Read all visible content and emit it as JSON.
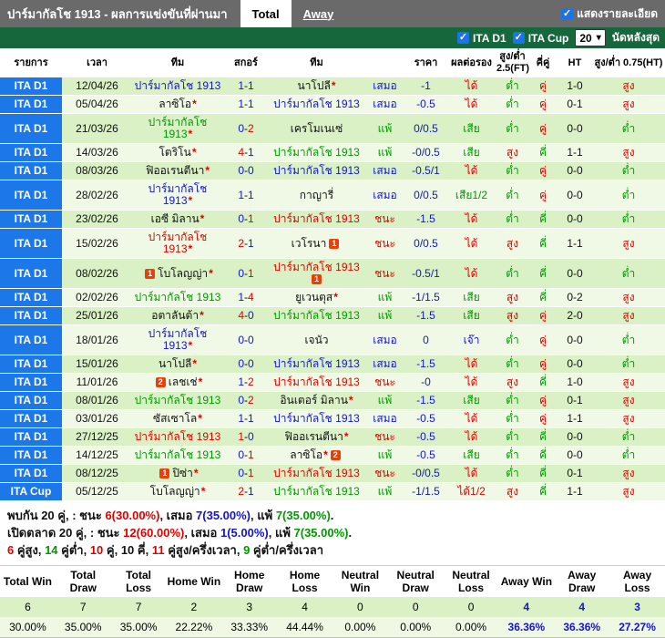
{
  "colors": {
    "win_red": "#e10000",
    "draw_blue": "#1414cc",
    "loss_green": "#009900",
    "league_bg_blue": "#1c78e8",
    "filter_bar_green": "#17673d",
    "title_bar_gray": "#6a6a6a",
    "checkbox_blue": "#1a73e8",
    "red_card": "#e6410c",
    "row_dark": "#d9f1c5",
    "row_light": "#f0f9e6"
  },
  "title_bar": {
    "title": "ปาร์มากัลโช 1913 - ผลการแข่งขันที่ผ่านมา",
    "tabs": [
      {
        "label": "Total",
        "active": true
      },
      {
        "label": "Away",
        "active": false
      }
    ],
    "detail_checkbox_label": "แสดงรายละเอียด",
    "check_glyph": "✓"
  },
  "filter_bar": {
    "checkboxes": [
      "ITA D1",
      "ITA Cup"
    ],
    "select_value": "20",
    "caret_glyph": "▾",
    "suffix_label": "นัดหลังสุด"
  },
  "table": {
    "headers": [
      "รายการ",
      "เวลา",
      "ทีม",
      "สกอร์",
      "ทีม",
      "",
      "ราคา",
      "ผลต่อรอง",
      "สูง/ต่ำ 2.5(FT)",
      "คี่คู่",
      "HT",
      "สูง/ต่ำ 0.75(HT)"
    ],
    "rows": [
      {
        "league": "ITA D1",
        "date": "12/04/26",
        "home": {
          "name": "ปาร์มากัลโช 1913",
          "res": "d"
        },
        "score": [
          1,
          1
        ],
        "away": {
          "name": "นาโปลี",
          "res": "k",
          "star": true
        },
        "result": "เสมอ",
        "odds": "-1",
        "handicap": "ได้",
        "ou25": "ต่ำ",
        "oe": "คู่",
        "ht": "1-0",
        "ou075": "สูง"
      },
      {
        "league": "ITA D1",
        "date": "05/04/26",
        "home": {
          "name": "ลาซิโอ",
          "res": "k",
          "star": true
        },
        "score": [
          1,
          1
        ],
        "away": {
          "name": "ปาร์มากัลโช 1913",
          "res": "d"
        },
        "result": "เสมอ",
        "odds": "-0.5",
        "handicap": "ได้",
        "ou25": "ต่ำ",
        "oe": "คู่",
        "ht": "0-1",
        "ou075": "สูง"
      },
      {
        "league": "ITA D1",
        "date": "21/03/26",
        "home": {
          "name": "ปาร์มากัลโช 1913",
          "res": "l",
          "star": true
        },
        "score": [
          0,
          2
        ],
        "away": {
          "name": "เครโมเนเซ่",
          "res": "k"
        },
        "result": "แพ้",
        "odds": "0/0.5",
        "handicap": "เสีย",
        "ou25": "ต่ำ",
        "oe": "คู่",
        "ht": "0-0",
        "ou075": "ต่ำ"
      },
      {
        "league": "ITA D1",
        "date": "14/03/26",
        "home": {
          "name": "โตริโน",
          "res": "k",
          "star": true
        },
        "score": [
          4,
          1
        ],
        "away": {
          "name": "ปาร์มากัลโช 1913",
          "res": "l"
        },
        "result": "แพ้",
        "odds": "-0/0.5",
        "handicap": "เสีย",
        "ou25": "สูง",
        "oe": "คี่",
        "ht": "1-1",
        "ou075": "สูง"
      },
      {
        "league": "ITA D1",
        "date": "08/03/26",
        "home": {
          "name": "ฟิออเรนตีนา",
          "res": "k",
          "star": true
        },
        "score": [
          0,
          0
        ],
        "away": {
          "name": "ปาร์มากัลโช 1913",
          "res": "d"
        },
        "result": "เสมอ",
        "odds": "-0.5/1",
        "handicap": "ได้",
        "ou25": "ต่ำ",
        "oe": "คู่",
        "ht": "0-0",
        "ou075": "ต่ำ"
      },
      {
        "league": "ITA D1",
        "date": "28/02/26",
        "home": {
          "name": "ปาร์มากัลโช 1913",
          "res": "d",
          "star": true
        },
        "score": [
          1,
          1
        ],
        "away": {
          "name": "กาญารี่",
          "res": "k"
        },
        "result": "เสมอ",
        "odds": "0/0.5",
        "handicap": "เสีย1/2",
        "ou25": "ต่ำ",
        "oe": "คู่",
        "ht": "0-0",
        "ou075": "ต่ำ"
      },
      {
        "league": "ITA D1",
        "date": "23/02/26",
        "home": {
          "name": "เอซี มิลาน",
          "res": "k",
          "star": true
        },
        "score": [
          0,
          1
        ],
        "away": {
          "name": "ปาร์มากัลโช 1913",
          "res": "w"
        },
        "result": "ชนะ",
        "odds": "-1.5",
        "handicap": "ได้",
        "ou25": "ต่ำ",
        "oe": "คี่",
        "ht": "0-0",
        "ou075": "ต่ำ"
      },
      {
        "league": "ITA D1",
        "date": "15/02/26",
        "home": {
          "name": "ปาร์มากัลโช 1913",
          "res": "w",
          "star": true
        },
        "score": [
          2,
          1
        ],
        "away": {
          "name": "เวโรนา",
          "res": "k",
          "cards": 1
        },
        "result": "ชนะ",
        "odds": "0/0.5",
        "handicap": "ได้",
        "ou25": "สูง",
        "oe": "คี่",
        "ht": "1-1",
        "ou075": "สูง"
      },
      {
        "league": "ITA D1",
        "date": "08/02/26",
        "home": {
          "name": "โบโลญญ่า",
          "res": "k",
          "star": true,
          "cards": 1
        },
        "score": [
          0,
          1
        ],
        "away": {
          "name": "ปาร์มากัลโช 1913",
          "res": "w",
          "cards": 1
        },
        "result": "ชนะ",
        "odds": "-0.5/1",
        "handicap": "ได้",
        "ou25": "ต่ำ",
        "oe": "คี่",
        "ht": "0-0",
        "ou075": "ต่ำ"
      },
      {
        "league": "ITA D1",
        "date": "02/02/26",
        "home": {
          "name": "ปาร์มากัลโช 1913",
          "res": "l"
        },
        "score": [
          1,
          4
        ],
        "away": {
          "name": "ยูเวนตุส",
          "res": "k",
          "star": true
        },
        "result": "แพ้",
        "odds": "-1/1.5",
        "handicap": "เสีย",
        "ou25": "สูง",
        "oe": "คี่",
        "ht": "0-2",
        "ou075": "สูง"
      },
      {
        "league": "ITA D1",
        "date": "25/01/26",
        "home": {
          "name": "อตาลันต้า",
          "res": "k",
          "star": true
        },
        "score": [
          4,
          0
        ],
        "away": {
          "name": "ปาร์มากัลโช 1913",
          "res": "l"
        },
        "result": "แพ้",
        "odds": "-1.5",
        "handicap": "เสีย",
        "ou25": "สูง",
        "oe": "คู่",
        "ht": "2-0",
        "ou075": "สูง"
      },
      {
        "league": "ITA D1",
        "date": "18/01/26",
        "home": {
          "name": "ปาร์มากัลโช 1913",
          "res": "d",
          "star": true
        },
        "score": [
          0,
          0
        ],
        "away": {
          "name": "เจนัว",
          "res": "k"
        },
        "result": "เสมอ",
        "odds": "0",
        "handicap": "เจ๊า",
        "ou25": "ต่ำ",
        "oe": "คู่",
        "ht": "0-0",
        "ou075": "ต่ำ"
      },
      {
        "league": "ITA D1",
        "date": "15/01/26",
        "home": {
          "name": "นาโปลี",
          "res": "k",
          "star": true
        },
        "score": [
          0,
          0
        ],
        "away": {
          "name": "ปาร์มากัลโช 1913",
          "res": "d"
        },
        "result": "เสมอ",
        "odds": "-1.5",
        "handicap": "ได้",
        "ou25": "ต่ำ",
        "oe": "คู่",
        "ht": "0-0",
        "ou075": "ต่ำ"
      },
      {
        "league": "ITA D1",
        "date": "11/01/26",
        "home": {
          "name": "เลชเช่",
          "res": "k",
          "star": true,
          "cards": 2
        },
        "score": [
          1,
          2
        ],
        "away": {
          "name": "ปาร์มากัลโช 1913",
          "res": "w"
        },
        "result": "ชนะ",
        "odds": "-0",
        "handicap": "ได้",
        "ou25": "สูง",
        "oe": "คี่",
        "ht": "1-0",
        "ou075": "สูง"
      },
      {
        "league": "ITA D1",
        "date": "08/01/26",
        "home": {
          "name": "ปาร์มากัลโช 1913",
          "res": "l"
        },
        "score": [
          0,
          2
        ],
        "away": {
          "name": "อินเตอร์ มิลาน",
          "res": "k",
          "star": true
        },
        "result": "แพ้",
        "odds": "-1.5",
        "handicap": "เสีย",
        "ou25": "ต่ำ",
        "oe": "คู่",
        "ht": "0-1",
        "ou075": "สูง"
      },
      {
        "league": "ITA D1",
        "date": "03/01/26",
        "home": {
          "name": "ซัสเซาโล",
          "res": "k",
          "star": true
        },
        "score": [
          1,
          1
        ],
        "away": {
          "name": "ปาร์มากัลโช 1913",
          "res": "d"
        },
        "result": "เสมอ",
        "odds": "-0.5",
        "handicap": "ได้",
        "ou25": "ต่ำ",
        "oe": "คู่",
        "ht": "1-1",
        "ou075": "สูง"
      },
      {
        "league": "ITA D1",
        "date": "27/12/25",
        "home": {
          "name": "ปาร์มากัลโช 1913",
          "res": "w"
        },
        "score": [
          1,
          0
        ],
        "away": {
          "name": "ฟิออเรนตีนา",
          "res": "k",
          "star": true
        },
        "result": "ชนะ",
        "odds": "-0.5",
        "handicap": "ได้",
        "ou25": "ต่ำ",
        "oe": "คี่",
        "ht": "0-0",
        "ou075": "ต่ำ"
      },
      {
        "league": "ITA D1",
        "date": "14/12/25",
        "home": {
          "name": "ปาร์มากัลโช 1913",
          "res": "l"
        },
        "score": [
          0,
          1
        ],
        "away": {
          "name": "ลาซิโอ",
          "res": "k",
          "star": true,
          "cards": 2
        },
        "result": "แพ้",
        "odds": "-0.5",
        "handicap": "เสีย",
        "ou25": "ต่ำ",
        "oe": "คี่",
        "ht": "0-0",
        "ou075": "ต่ำ"
      },
      {
        "league": "ITA D1",
        "date": "08/12/25",
        "home": {
          "name": "ปิซ่า",
          "res": "k",
          "star": true,
          "cards": 1
        },
        "score": [
          0,
          1
        ],
        "away": {
          "name": "ปาร์มากัลโช 1913",
          "res": "w"
        },
        "result": "ชนะ",
        "odds": "-0/0.5",
        "handicap": "ได้",
        "ou25": "ต่ำ",
        "oe": "คี่",
        "ht": "0-1",
        "ou075": "สูง"
      },
      {
        "league": "ITA Cup",
        "date": "05/12/25",
        "home": {
          "name": "โบโลญญ่า",
          "res": "k",
          "star": true
        },
        "score": [
          2,
          1
        ],
        "away": {
          "name": "ปาร์มากัลโช 1913",
          "res": "l"
        },
        "result": "แพ้",
        "odds": "-1/1.5",
        "handicap": "ได้1/2",
        "ou25": "สูง",
        "oe": "คี่",
        "ht": "1-1",
        "ou075": "สูง"
      }
    ]
  },
  "value_colors": {
    "ชนะ": "r",
    "เสมอ": "b",
    "แพ้": "g",
    "ได้": "r",
    "เสีย": "g",
    "เจ๊า": "b",
    "ได้1/2": "r",
    "เสีย1/2": "g",
    "สูง": "r",
    "ต่ำ": "g",
    "คู่": "r",
    "คี่": "g"
  },
  "summary": {
    "lines": [
      [
        [
          "พบกัน ",
          "k"
        ],
        [
          "20",
          "k"
        ],
        [
          " คู่, : ชนะ ",
          "k"
        ],
        [
          "6(30.00%)",
          "r"
        ],
        [
          ", เสมอ ",
          "k"
        ],
        [
          "7(35.00%)",
          "b"
        ],
        [
          ", แพ้ ",
          "k"
        ],
        [
          "7(35.00%)",
          "g"
        ],
        [
          ".",
          "k"
        ]
      ],
      [
        [
          "เปิดตลาด ",
          "k"
        ],
        [
          "20",
          "k"
        ],
        [
          " คู่, : ชนะ ",
          "k"
        ],
        [
          "12(60.00%)",
          "r"
        ],
        [
          ", เสมอ ",
          "k"
        ],
        [
          "1(5.00%)",
          "b"
        ],
        [
          ", แพ้ ",
          "k"
        ],
        [
          "7(35.00%)",
          "g"
        ],
        [
          ".",
          "k"
        ]
      ],
      [
        [
          "6",
          "r"
        ],
        [
          " คู่สูง, ",
          "k"
        ],
        [
          "14",
          "g"
        ],
        [
          " คู่ต่ำ, ",
          "k"
        ],
        [
          "10",
          "r"
        ],
        [
          " คู่, ",
          "k"
        ],
        [
          "10",
          "k"
        ],
        [
          " คี่, ",
          "k"
        ],
        [
          "11",
          "r"
        ],
        [
          " คู่สูง/ครึ่งเวลา, ",
          "k"
        ],
        [
          "9",
          "g"
        ],
        [
          " คู่ต่ำ/ครึ่งเวลา",
          "k"
        ]
      ]
    ]
  },
  "stats_table": {
    "columns": [
      "Total Win",
      "Total Draw",
      "Total Loss",
      "Home Win",
      "Home Draw",
      "Home Loss",
      "Neutral Win",
      "Neutral Draw",
      "Neutral Loss",
      "Away Win",
      "Away Draw",
      "Away Loss"
    ],
    "counts": [
      "6",
      "7",
      "7",
      "2",
      "3",
      "4",
      "0",
      "0",
      "0",
      "4",
      "4",
      "3"
    ],
    "percents": [
      "30.00%",
      "35.00%",
      "35.00%",
      "22.22%",
      "33.33%",
      "44.44%",
      "0.00%",
      "0.00%",
      "0.00%",
      "36.36%",
      "36.36%",
      "27.27%"
    ],
    "highlight_from": 9
  }
}
